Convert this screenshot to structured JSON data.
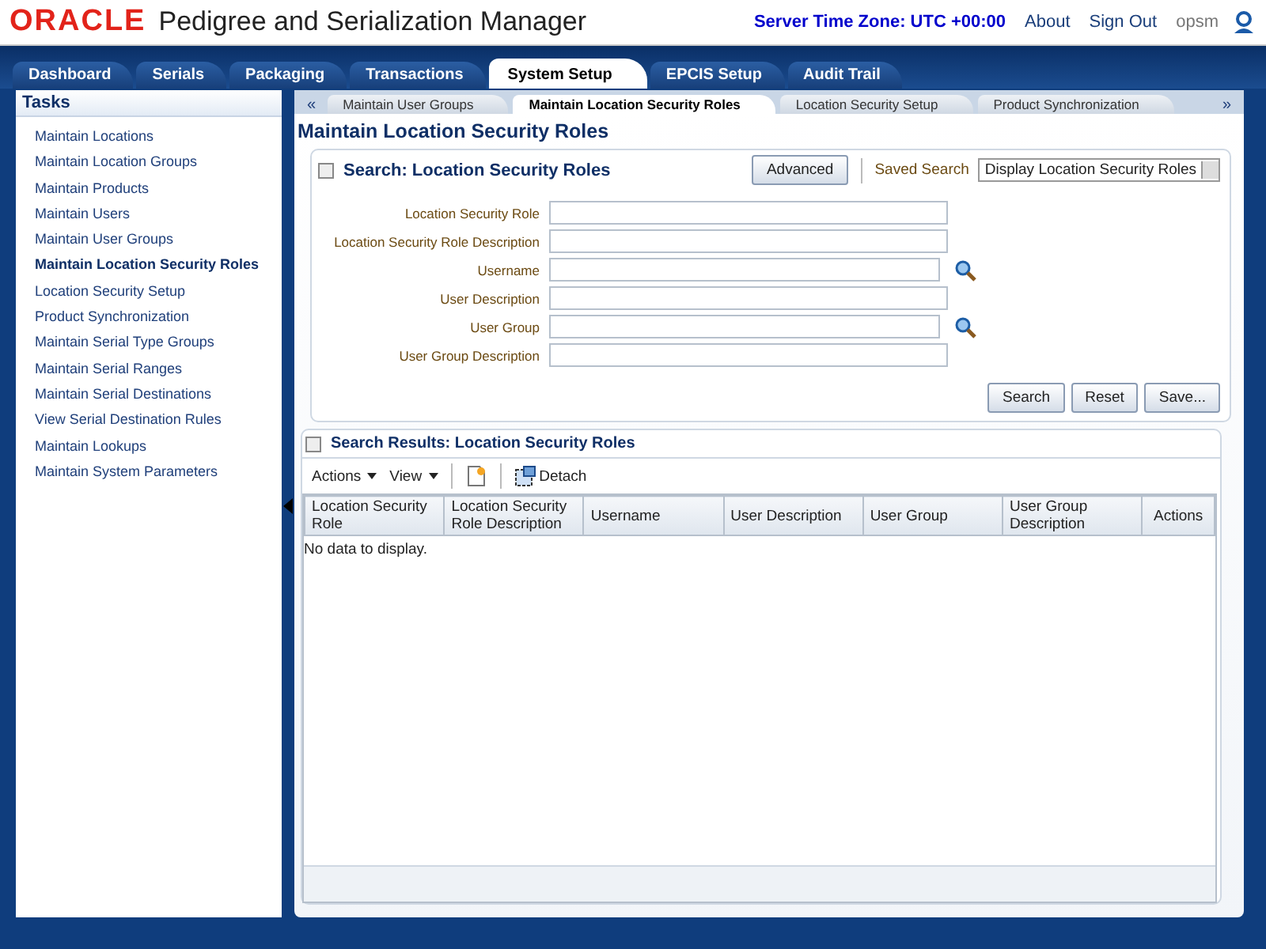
{
  "header": {
    "logo": "ORACLE",
    "app_title": "Pedigree and Serialization Manager",
    "server_time": "Server Time Zone: UTC +00:00",
    "links": [
      "About",
      "Sign Out"
    ],
    "user": "opsm"
  },
  "main_tabs": [
    {
      "label": "Dashboard",
      "selected": false
    },
    {
      "label": "Serials",
      "selected": false
    },
    {
      "label": "Packaging",
      "selected": false
    },
    {
      "label": "Transactions",
      "selected": false
    },
    {
      "label": "System Setup",
      "selected": true
    },
    {
      "label": "EPCIS Setup",
      "selected": false
    },
    {
      "label": "Audit Trail",
      "selected": false
    }
  ],
  "sidebar": {
    "title": "Tasks",
    "items": [
      {
        "label": "Maintain Locations",
        "selected": false
      },
      {
        "label": "Maintain Location Groups",
        "selected": false
      },
      {
        "label": "Maintain Products",
        "selected": false
      },
      {
        "label": "Maintain Users",
        "selected": false
      },
      {
        "label": "Maintain User Groups",
        "selected": false
      },
      {
        "label": "Maintain Location Security Roles",
        "selected": true
      },
      {
        "label": "Location Security Setup",
        "selected": false
      },
      {
        "label": "Product Synchronization",
        "selected": false
      },
      {
        "label": "Maintain Serial Type Groups",
        "selected": false
      },
      {
        "label": "Maintain Serial Ranges",
        "selected": false
      },
      {
        "label": "Maintain Serial Destinations",
        "selected": false
      },
      {
        "label": "View Serial Destination Rules",
        "selected": false
      },
      {
        "label": "Maintain Lookups",
        "selected": false
      },
      {
        "label": "Maintain System Parameters",
        "selected": false
      }
    ]
  },
  "sub_tabs": {
    "prev": "«",
    "next": "»",
    "items": [
      {
        "label": "Maintain User Groups",
        "selected": false
      },
      {
        "label": "Maintain Location Security Roles",
        "selected": true
      },
      {
        "label": "Location Security Setup",
        "selected": false
      },
      {
        "label": "Product Synchronization",
        "selected": false
      }
    ]
  },
  "page_title": "Maintain Location Security Roles",
  "search": {
    "title": "Search: Location Security Roles",
    "advanced": "Advanced",
    "saved_search_label": "Saved Search",
    "saved_search_value": "Display Location Security Roles",
    "fields": [
      {
        "label": "Location Security Role",
        "kind": "text"
      },
      {
        "label": "Location Security Role Description",
        "kind": "text"
      },
      {
        "label": "Username",
        "kind": "lookup"
      },
      {
        "label": "User Description",
        "kind": "text"
      },
      {
        "label": "User Group",
        "kind": "lookup"
      },
      {
        "label": "User Group Description",
        "kind": "text"
      }
    ],
    "buttons": [
      "Search",
      "Reset",
      "Save..."
    ]
  },
  "results": {
    "title": "Search Results: Location Security Roles",
    "menus": [
      "Actions",
      "View"
    ],
    "detach": "Detach",
    "columns": [
      "Location Security Role",
      "Location Security Role Description",
      "Username",
      "User Description",
      "User Group",
      "User Group Description",
      "Actions"
    ],
    "empty_message": "No data to display."
  }
}
